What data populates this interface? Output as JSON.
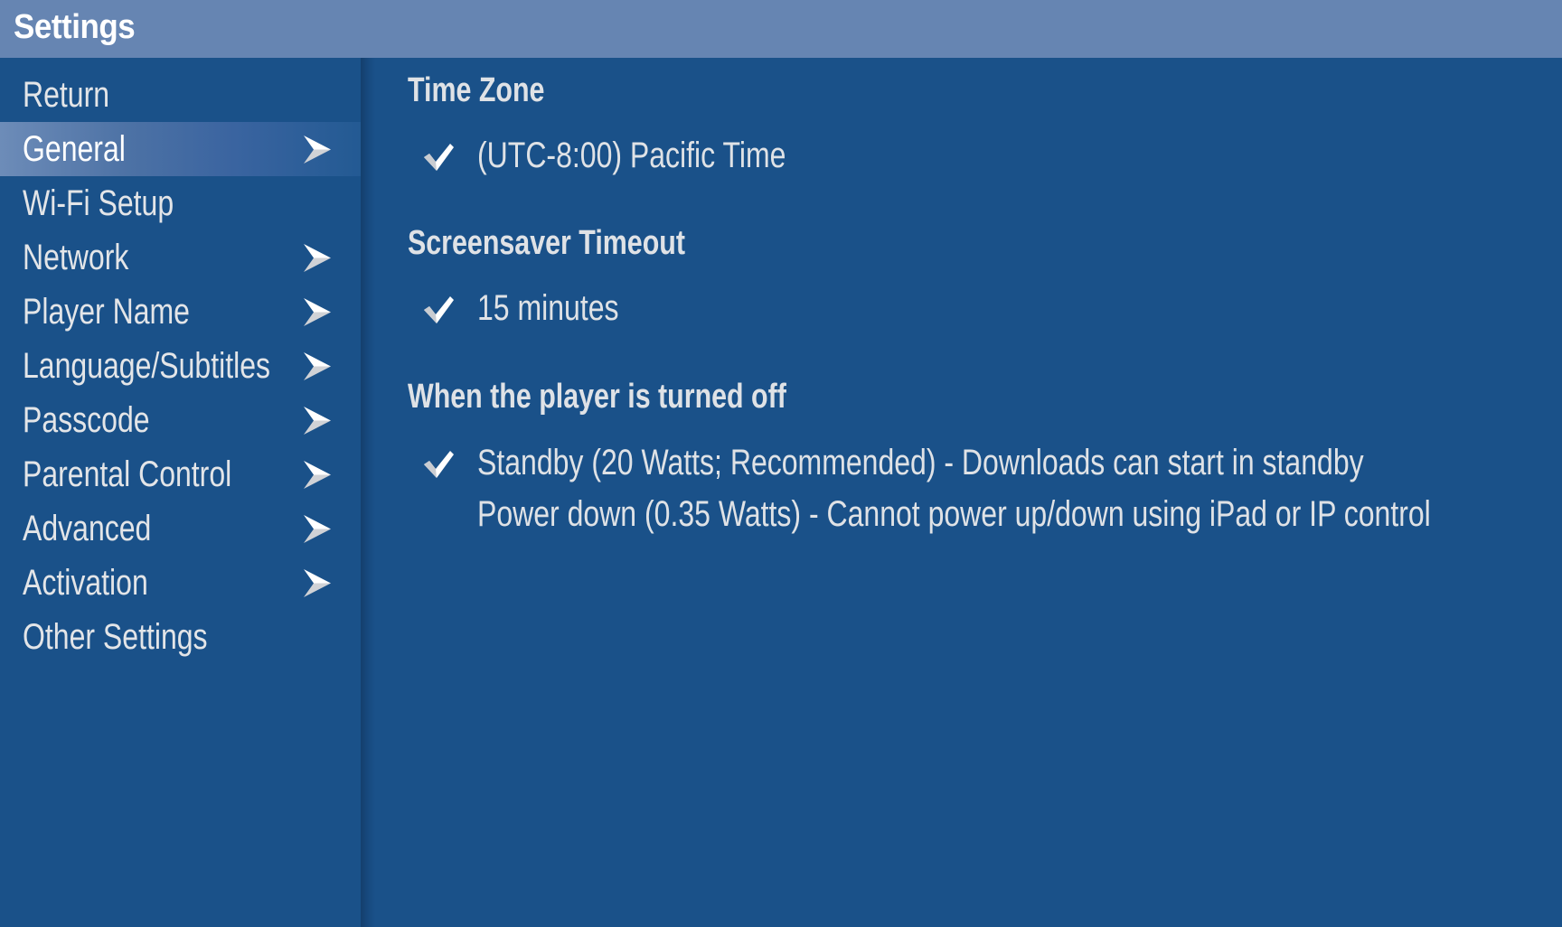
{
  "header": {
    "title": "Settings"
  },
  "sidebar": {
    "items": [
      {
        "label": "Return",
        "has_arrow": false,
        "selected": false
      },
      {
        "label": "General",
        "has_arrow": true,
        "selected": true
      },
      {
        "label": "Wi-Fi Setup",
        "has_arrow": false,
        "selected": false
      },
      {
        "label": "Network",
        "has_arrow": true,
        "selected": false
      },
      {
        "label": "Player Name",
        "has_arrow": true,
        "selected": false
      },
      {
        "label": "Language/Subtitles",
        "has_arrow": true,
        "selected": false
      },
      {
        "label": "Passcode",
        "has_arrow": true,
        "selected": false
      },
      {
        "label": "Parental Control",
        "has_arrow": true,
        "selected": false
      },
      {
        "label": "Advanced",
        "has_arrow": true,
        "selected": false
      },
      {
        "label": "Activation",
        "has_arrow": true,
        "selected": false
      },
      {
        "label": "Other Settings",
        "has_arrow": false,
        "selected": false
      }
    ]
  },
  "main": {
    "sections": [
      {
        "title": "Time Zone",
        "options": [
          {
            "label": "(UTC-8:00) Pacific Time",
            "checked": true
          }
        ]
      },
      {
        "title": "Screensaver Timeout",
        "options": [
          {
            "label": "15 minutes",
            "checked": true
          }
        ]
      },
      {
        "title": "When the player is turned off",
        "options": [
          {
            "label": "Standby (20 Watts; Recommended) - Downloads can start in standby",
            "checked": true
          },
          {
            "label": "Power down (0.35 Watts) - Cannot power up/down using iPad or IP control",
            "checked": false
          }
        ]
      }
    ]
  },
  "colors": {
    "background": "#1a5189",
    "header": "#6685b2",
    "text": "#e1e4e8",
    "selected_gradient_start": "#6d8cb8"
  },
  "icons": {
    "nav_arrow": "chevron-right-arrow-icon",
    "check": "checkmark-icon"
  }
}
